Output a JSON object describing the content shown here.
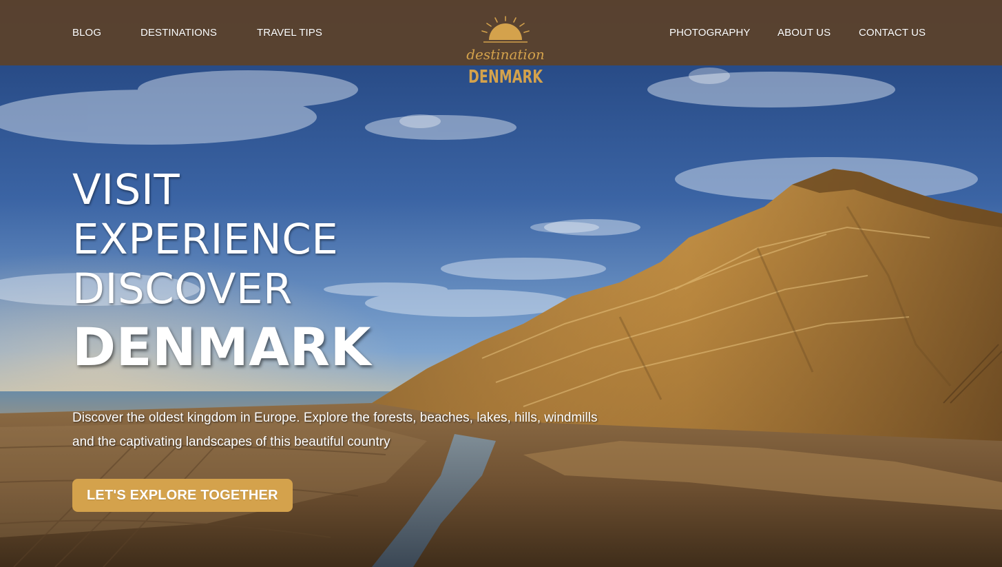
{
  "nav": {
    "left": [
      {
        "label": "BLOG"
      },
      {
        "label": "DESTINATIONS"
      },
      {
        "label": "TRAVEL TIPS"
      }
    ],
    "right": [
      {
        "label": "PHOTOGRAPHY"
      },
      {
        "label": "ABOUT US"
      },
      {
        "label": "CONTACT US"
      }
    ]
  },
  "logo": {
    "line1": "destination",
    "line2": "DENMARK",
    "icon": "sun-icon",
    "color": "#d4a24c"
  },
  "hero": {
    "line1": "VISIT",
    "line2": "EXPERIENCE",
    "line3": "DISCOVER",
    "title": "DENMARK",
    "description_line1": "Discover the oldest kingdom in Europe. Explore the forests, beaches, lakes, hills, windmills",
    "description_line2": "and the captivating landscapes of this beautiful country",
    "cta_label": "LET'S EXPLORE TOGETHER"
  },
  "colors": {
    "nav_bg": "#5c422a",
    "accent": "#d4a24c",
    "text": "#ffffff"
  }
}
